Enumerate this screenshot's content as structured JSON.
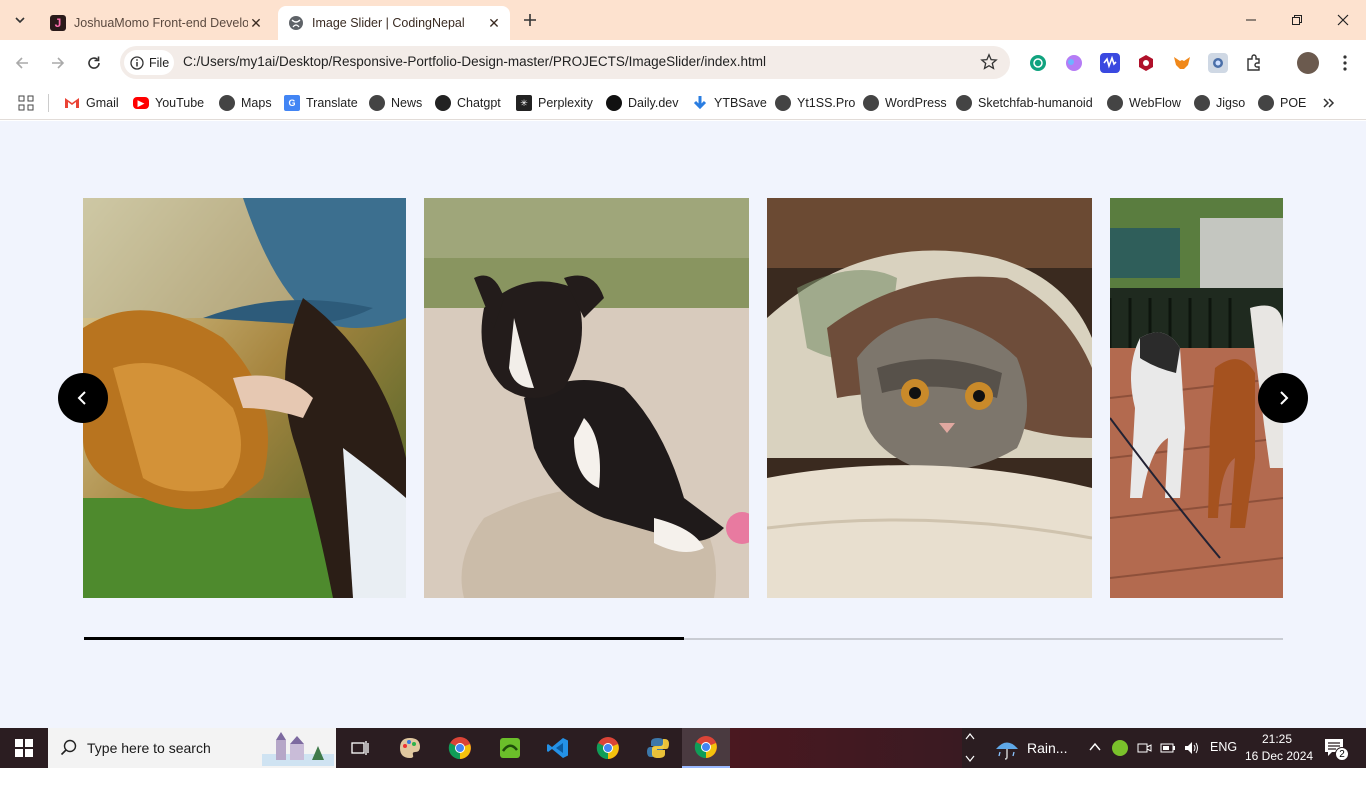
{
  "browser": {
    "tabs": [
      {
        "title": "JoshuaMomo Front-end Develo",
        "active": false
      },
      {
        "title": "Image Slider | CodingNepal",
        "active": true
      }
    ],
    "omnibox": {
      "scheme_chip": "File",
      "url": "C:/Users/my1ai/Desktop/Responsive-Portfolio-Design-master/PROJECTS/ImageSlider/index.html"
    },
    "bookmarks": [
      {
        "label": "Gmail",
        "icon": "gmail-icon"
      },
      {
        "label": "YouTube",
        "icon": "youtube-icon"
      },
      {
        "label": "Maps",
        "icon": "globe-icon"
      },
      {
        "label": "Translate",
        "icon": "translate-icon"
      },
      {
        "label": "News",
        "icon": "globe-icon"
      },
      {
        "label": "Chatgpt",
        "icon": "chatgpt-icon"
      },
      {
        "label": "Perplexity",
        "icon": "perplexity-icon"
      },
      {
        "label": "Daily.dev",
        "icon": "dailydev-icon"
      },
      {
        "label": "YTBSave",
        "icon": "download-icon"
      },
      {
        "label": "Yt1SS.Pro",
        "icon": "globe-icon"
      },
      {
        "label": "WordPress",
        "icon": "globe-icon"
      },
      {
        "label": "Sketchfab-humanoid",
        "icon": "globe-icon"
      },
      {
        "label": "WebFlow",
        "icon": "globe-icon"
      },
      {
        "label": "Jigso",
        "icon": "globe-icon"
      },
      {
        "label": "POE",
        "icon": "globe-icon"
      }
    ]
  },
  "slider": {
    "slides": [
      {
        "name": "woman-with-golden-retriever"
      },
      {
        "name": "puppy-on-sand"
      },
      {
        "name": "kitten-under-blanket"
      },
      {
        "name": "dogs-on-leash-street"
      }
    ],
    "scroll_progress": 0.5
  },
  "taskbar": {
    "search_placeholder": "Type here to search",
    "weather": "Rain...",
    "language": "ENG",
    "time": "21:25",
    "date": "16 Dec 2024",
    "notification_count": "2"
  },
  "colors": {
    "tabstrip": "#fde2cf",
    "page_bg": "#f1f4fd",
    "taskbar": "#2b1d21"
  }
}
